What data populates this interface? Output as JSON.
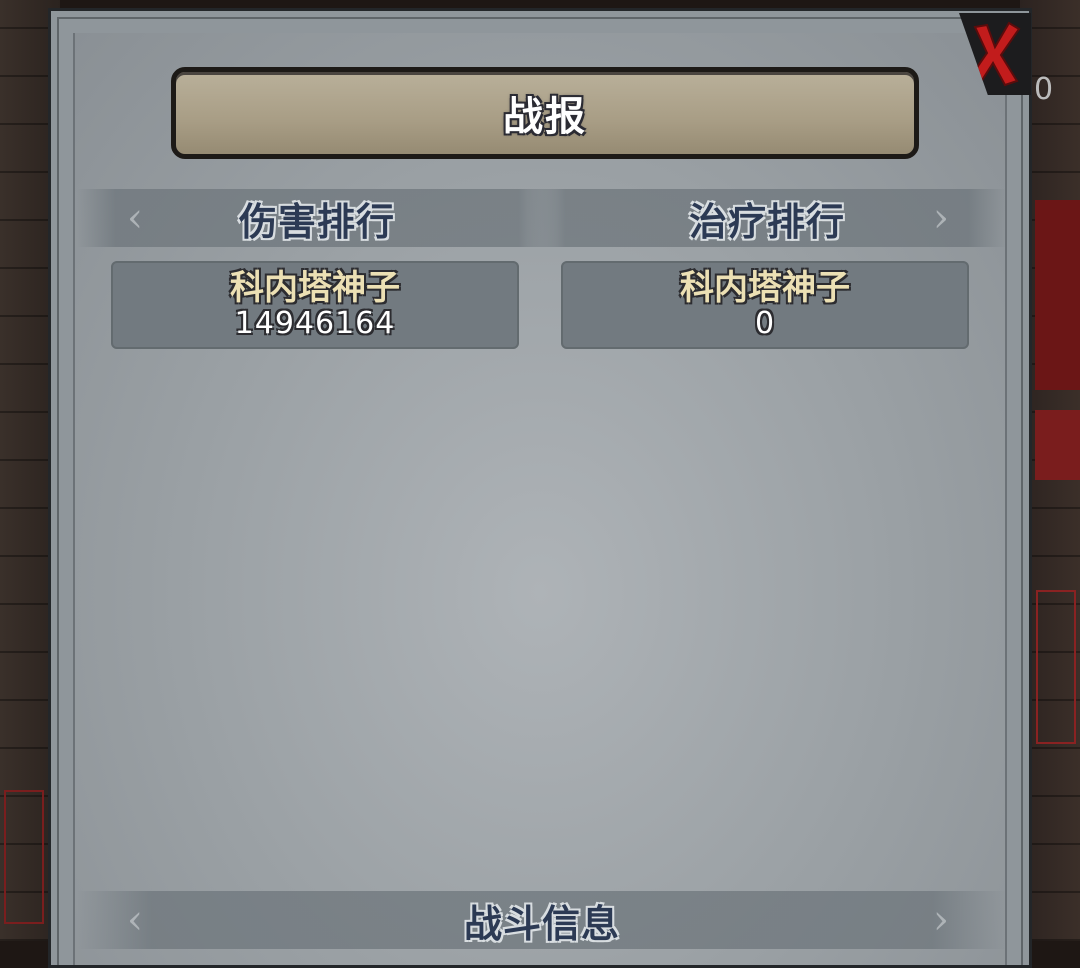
{
  "background": {
    "partial_counter": "0"
  },
  "dialog": {
    "title": "战报",
    "close_icon": "close-x-icon"
  },
  "damage_ranking": {
    "header": "伤害排行",
    "entries": [
      {
        "name": "科内塔神子",
        "value": "14946164"
      }
    ]
  },
  "healing_ranking": {
    "header": "治疗排行",
    "entries": [
      {
        "name": "科内塔神子",
        "value": "0"
      }
    ]
  },
  "battle_info": {
    "header": "战斗信息"
  },
  "colors": {
    "title_banner": "#a89d85",
    "header_text": "#2c3a54",
    "entry_name": "#ece0b4",
    "close_x": "#c21c1c"
  }
}
